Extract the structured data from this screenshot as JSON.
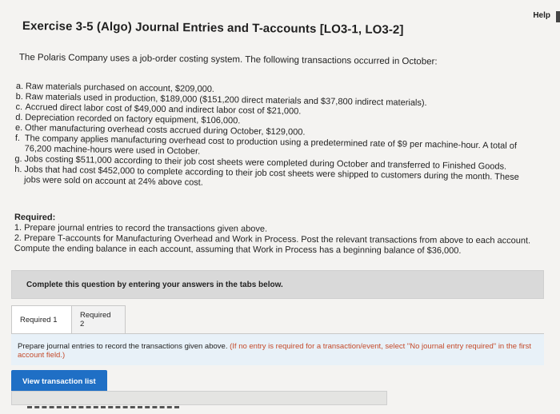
{
  "header": {
    "help_label": "Help",
    "title": "Exercise 3-5 (Algo) Journal Entries and T-accounts [LO3-1, LO3-2]"
  },
  "problem": {
    "intro": "The Polaris Company uses a job-order costing system. The following transactions occurred in October:",
    "transactions": [
      {
        "letter": "a.",
        "text": "Raw materials purchased on account, $209,000."
      },
      {
        "letter": "b.",
        "text": "Raw materials used in production, $189,000 ($151,200 direct materials and $37,800 indirect materials)."
      },
      {
        "letter": "c.",
        "text": "Accrued direct labor cost of $49,000 and indirect labor cost of $21,000."
      },
      {
        "letter": "d.",
        "text": "Depreciation recorded on factory equipment, $106,000."
      },
      {
        "letter": "e.",
        "text": "Other manufacturing overhead costs accrued during October, $129,000."
      },
      {
        "letter": "f.",
        "text": "The company applies manufacturing overhead cost to production using a predetermined rate of $9 per machine-hour. A total of 76,200 machine-hours were used in October."
      },
      {
        "letter": "g.",
        "text": "Jobs costing $511,000 according to their job cost sheets were completed during October and transferred to Finished Goods."
      },
      {
        "letter": "h.",
        "text": "Jobs that had cost $452,000 to complete according to their job cost sheets were shipped to customers during the month. These jobs were sold on account at 24% above cost."
      }
    ],
    "required_heading": "Required:",
    "required_1": "1. Prepare journal entries to record the transactions given above.",
    "required_2": "2. Prepare T-accounts for Manufacturing Overhead and Work in Process. Post the relevant transactions from above to each account. Compute the ending balance in each account, assuming that Work in Process has a beginning balance of $36,000."
  },
  "complete_banner": "Complete this question by entering your answers in the tabs below.",
  "tabs": [
    {
      "label": "Required 1"
    },
    {
      "label": "Required 2"
    }
  ],
  "instruction": {
    "main": "Prepare journal entries to record the transactions given above.",
    "note": "(If no entry is required for a transaction/event, select \"No journal entry required\" in the first account field.)"
  },
  "buttons": {
    "view_transaction_list": "View transaction list"
  },
  "colors": {
    "accent": "#1f6fc5",
    "note": "#c44a2a",
    "instruction_bg": "#e8f1f8"
  }
}
